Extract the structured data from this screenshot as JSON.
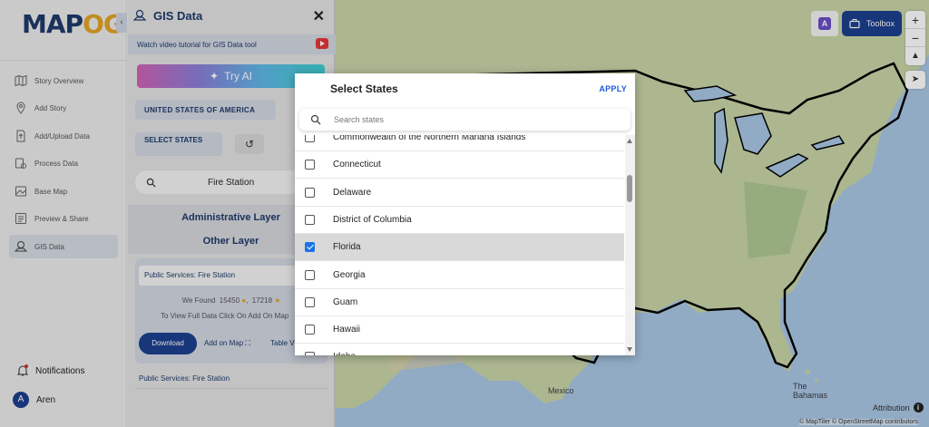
{
  "nav": {
    "logo_text_main": "MAP",
    "logo_text_accent": "OG",
    "collapse_icon": "chevron-left-icon",
    "items": [
      {
        "label": "Story Overview",
        "icon": "map-icon"
      },
      {
        "label": "Add Story",
        "icon": "pin-icon"
      },
      {
        "label": "Add/Upload Data",
        "icon": "upload-file-icon"
      },
      {
        "label": "Process Data",
        "icon": "process-data-icon"
      },
      {
        "label": "Base Map",
        "icon": "basemap-icon"
      },
      {
        "label": "Preview & Share",
        "icon": "preview-icon"
      },
      {
        "label": "GIS Data",
        "icon": "gis-data-icon",
        "active": true
      }
    ],
    "notifications_label": "Notifications",
    "user_name": "Aren",
    "user_initial": "A"
  },
  "panel": {
    "title": "GIS Data",
    "tutorial_text": "Watch video tutorial for GIS Data tool",
    "try_ai_label": "Try AI",
    "country_label": "UNITED STATES OF AMERICA",
    "select_states_label": "SELECT STATES",
    "search_value": "Fire Station",
    "administrative_layer": "Administrative Layer",
    "other_layer": "Other Layer",
    "result": {
      "title": "Public Services: Fire Station",
      "found_prefix": "We Found",
      "count_a": "15450",
      "count_b": "17218",
      "hint": "To View Full Data Click On Add On Map",
      "download_label": "Download",
      "add_on_map_label": "Add on Map",
      "table_view_label": "Table View"
    },
    "footer_item": "Public Services: Fire Station"
  },
  "map": {
    "toolbox_label": "Toolbox",
    "zoom_in": "+",
    "zoom_out": "−",
    "attribution_label": "Attribution",
    "credit": "© MapTiler © OpenStreetMap contributors",
    "labels": {
      "mexico": "Mexico",
      "the_bahamas": "The\nBahamas"
    },
    "colors": {
      "land": "#c9d6a8",
      "water": "#a9c7e6",
      "accent": "#1d3f8f"
    }
  },
  "modal": {
    "title": "Select States",
    "apply_label": "APPLY",
    "search_placeholder": "Search states",
    "states": [
      {
        "name": "Commonwealth of the Northern Mariana Islands",
        "checked": false
      },
      {
        "name": "Connecticut",
        "checked": false
      },
      {
        "name": "Delaware",
        "checked": false
      },
      {
        "name": "District of Columbia",
        "checked": false
      },
      {
        "name": "Florida",
        "checked": true
      },
      {
        "name": "Georgia",
        "checked": false
      },
      {
        "name": "Guam",
        "checked": false
      },
      {
        "name": "Hawaii",
        "checked": false
      },
      {
        "name": "Idaho",
        "checked": false
      }
    ]
  }
}
